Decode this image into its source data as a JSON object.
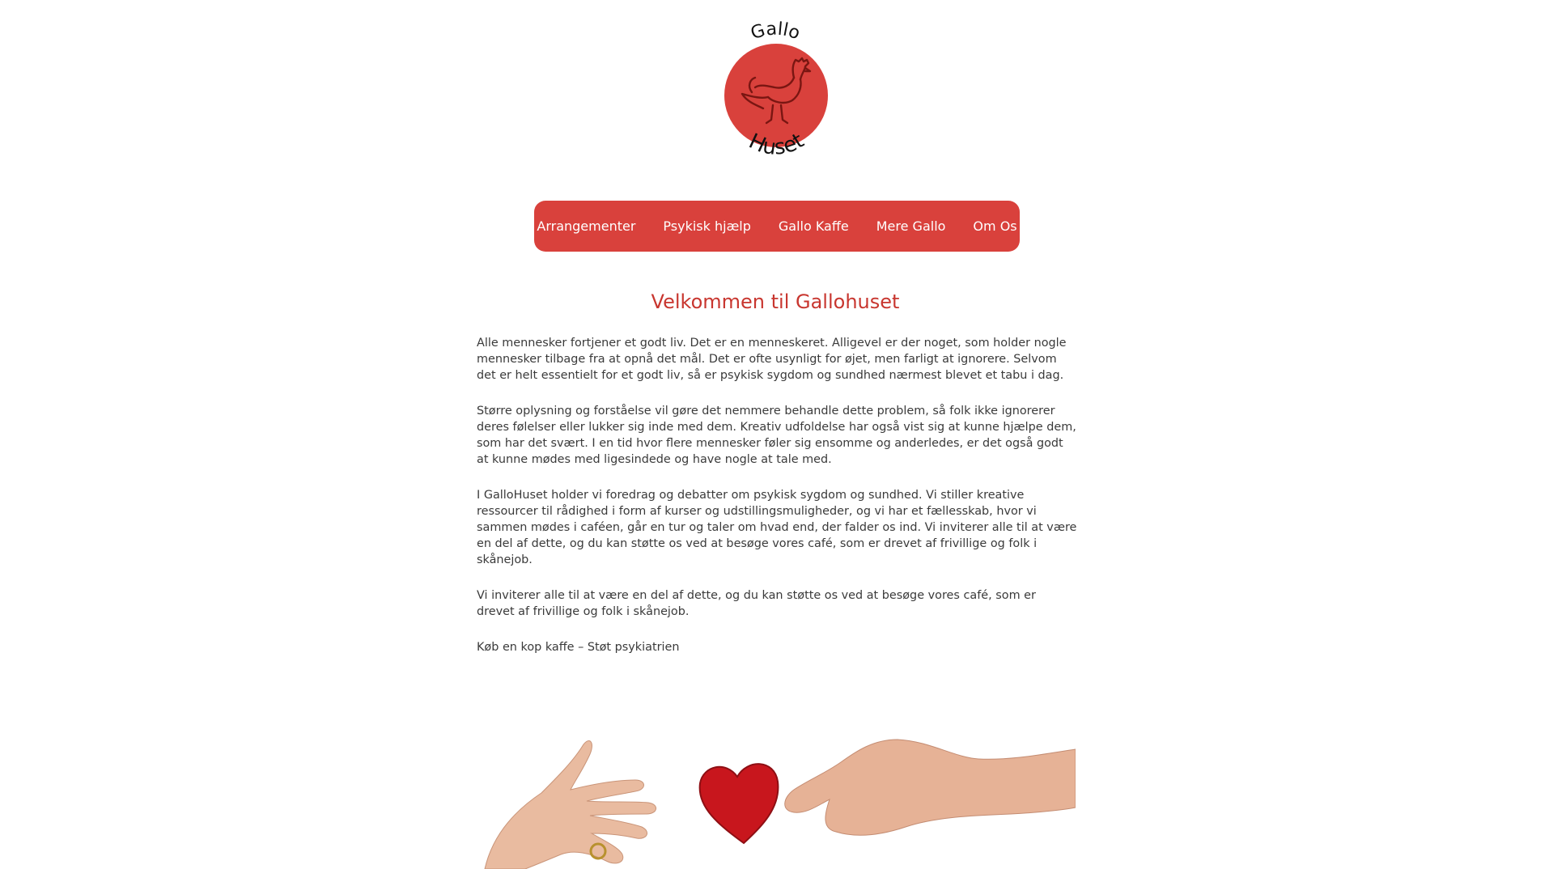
{
  "logo": {
    "text_top": "Gallo",
    "text_bottom": "Huset",
    "circle_color": "#d9413c",
    "icon": "rooster-icon"
  },
  "nav": {
    "background": "#d9413c",
    "items": [
      {
        "label": "Arrangementer"
      },
      {
        "label": "Psykisk hjælp"
      },
      {
        "label": "Gallo Kaffe"
      },
      {
        "label": "Mere Gallo"
      },
      {
        "label": "Om Os"
      }
    ]
  },
  "main": {
    "heading": "Velkommen til Gallohuset",
    "heading_color": "#c8362f",
    "paragraphs": [
      "Alle mennesker fortjener et godt liv. Det er en menneskeret. Alligevel er der noget, som holder nogle mennesker tilbage fra at opnå det mål. Det er ofte usynligt for øjet, men farligt at ignorere. Selvom det er helt essentielt for et godt liv, så er psykisk sygdom og sundhed nærmest blevet et tabu i dag.",
      "Større oplysning og forståelse vil gøre det nemmere behandle dette problem, så folk ikke ignorerer deres følelser eller lukker sig inde med dem. Kreativ udfoldelse har også vist sig at kunne hjælpe dem, som har det svært. I en tid hvor flere mennesker føler sig ensomme og anderledes, er det også godt at kunne mødes med ligesindede og have nogle at tale med.",
      "I GalloHuset holder vi foredrag og debatter om psykisk sygdom og sundhed. Vi stiller kreative ressourcer til rådighed i form af kurser og udstillingsmuligheder, og vi har et fællesskab, hvor vi sammen mødes i caféen, går en tur og taler om hvad end, der falder os ind. Vi inviterer alle til at være en del af dette, og du kan støtte os ved at besøge vores café, som er drevet af frivillige og folk i skånejob.",
      "Vi inviterer alle til at være en del af dette, og du kan støtte os ved at besøge vores café, som er drevet af frivillige og folk i skånejob."
    ],
    "tagline": "Køb en kop kaffe – Støt psykiatrien"
  },
  "hero": {
    "description_icon": "hands-giving-heart-icon",
    "heart_color": "#c8161d"
  }
}
